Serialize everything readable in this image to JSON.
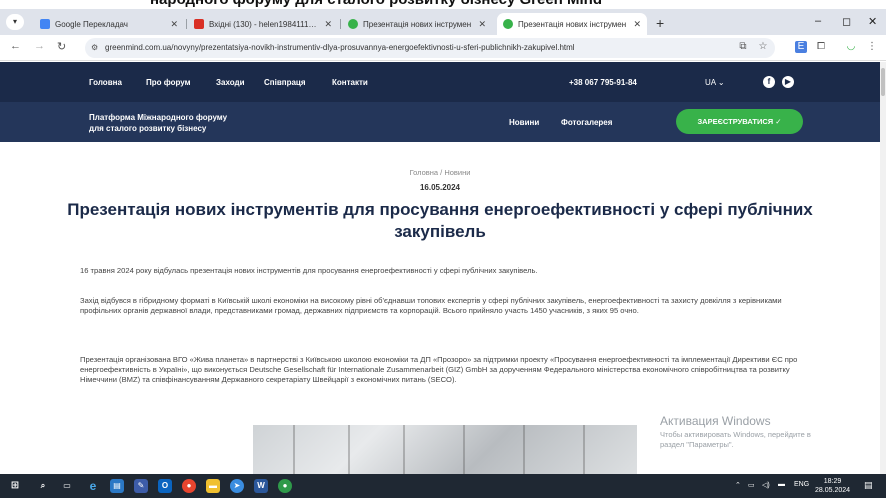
{
  "overlay_text": "народного форуму для сталого розвитку бізнесу Green Mind",
  "browser": {
    "tabs": [
      {
        "label": "Google Перекладач",
        "favicon_color": "#4285f4"
      },
      {
        "label": "Вхідні (130) - helen1984111@g",
        "favicon_color": "#d93025"
      },
      {
        "label": "Презентація нових інструмен",
        "favicon_color": "#38b24a"
      },
      {
        "label": "Презентація нових інструмен",
        "favicon_color": "#38b24a"
      }
    ],
    "tab_menu_icon": "▾",
    "new_tab": "+",
    "window_controls": [
      "–",
      "◻",
      "✕"
    ],
    "url": "greenmind.com.ua/novyny/prezentatsiya-novikh-instrumentiv-dlya-prosuvannya-energoefektivnosti-u-sferi-publichnikh-zakupivel.html"
  },
  "site": {
    "nav": [
      "Головна",
      "Про форум",
      "Заходи",
      "Співпраця",
      "Контакти"
    ],
    "phone": "+38 067 795-91-84",
    "lang": "UA ⌄",
    "platform_line1": "Платформа Міжнародного форуму",
    "platform_line2": "для сталого розвитку бізнесу",
    "sub_nav": [
      "Новини",
      "Фотогалерея"
    ],
    "register": "ЗАРЕЄСТРУВАТИСЯ ✓"
  },
  "article": {
    "breadcrumb": "Головна  /  Новини",
    "date": "16.05.2024",
    "title": "Презентація нових інструментів для просування енергоефективності у сфері публічних закупівель",
    "p1": "16 травня 2024 року відбулась презентація нових інструментів для просування енергоефективності у сфері публічних закупівель.",
    "p2": "Захід відбувся в гібридному форматі в Київській школі економіки на високому рівні об'єднавши топових експертів у сфері публічних закупівель, енергоефективності та захисту довкілля з керівниками профільних органів державної влади, представниками громад, державних підприємств та корпорацій. Всього прийняло участь 1450 учасників, з яких 95 очно.",
    "p3": "Презентація організована ВГО «Жива планета» в партнерстві з Київською школою економіки та ДП «Прозоро» за підтримки проекту «Просування енергоефективності та імплементації Директиви ЄС про енергоефективність в Україні», що виконується Deutsche Gesellschaft für Internationale Zusammenarbeit (GIZ) GmbH за дорученням Федерального міністерства економічного співробітництва та розвитку Німеччини (BMZ) та співфінансуванням Державного секретаріату Швейцарії з економічних питань (SECO)."
  },
  "watermark": {
    "title": "Активация Windows",
    "line1": "Чтобы активировать Windows, перейдите в",
    "line2": "раздел \"Параметры\"."
  },
  "taskbar": {
    "lang": "ENG",
    "time": "18:29",
    "date": "28.05.2024"
  },
  "colors": {
    "header_dark": "#1b2a49",
    "accent_green": "#38b24a",
    "title_color": "#1b2a49"
  }
}
